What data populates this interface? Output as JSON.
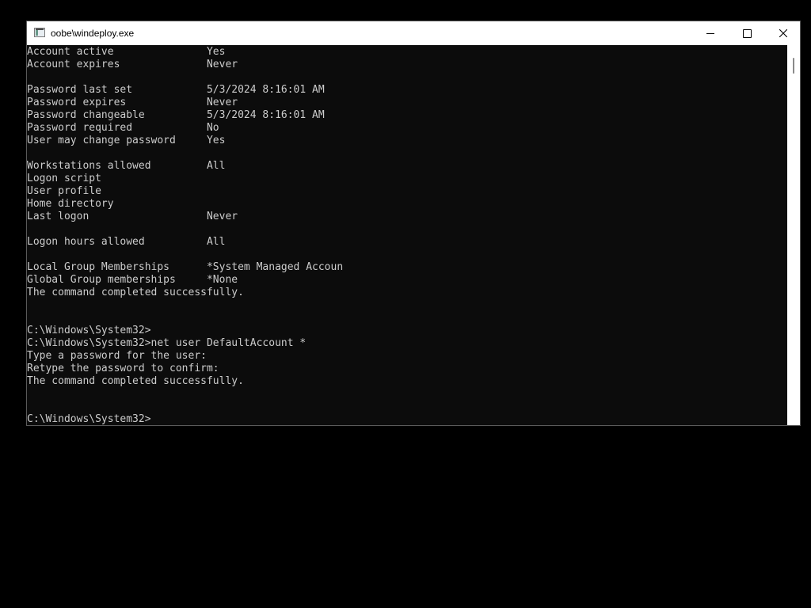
{
  "window": {
    "title": "oobe\\windeploy.exe"
  },
  "console": {
    "text": "Account active               Yes\nAccount expires              Never\n\nPassword last set            5/3/2024 8:16:01 AM\nPassword expires             Never\nPassword changeable          5/3/2024 8:16:01 AM\nPassword required            No\nUser may change password     Yes\n\nWorkstations allowed         All\nLogon script\nUser profile\nHome directory\nLast logon                   Never\n\nLogon hours allowed          All\n\nLocal Group Memberships      *System Managed Accoun\nGlobal Group memberships     *None\nThe command completed successfully.\n\n\nC:\\Windows\\System32>\nC:\\Windows\\System32>net user DefaultAccount *\nType a password for the user:\nRetype the password to confirm:\nThe command completed successfully.\n\n\nC:\\Windows\\System32>"
  },
  "icons": {
    "app": "console-window-icon",
    "minimize": "minimize-icon",
    "maximize": "maximize-icon",
    "close": "close-icon"
  },
  "colors": {
    "console_bg": "#0c0c0c",
    "console_text": "#cccccc",
    "titlebar_bg": "#ffffff",
    "desktop_bg": "#000000"
  }
}
